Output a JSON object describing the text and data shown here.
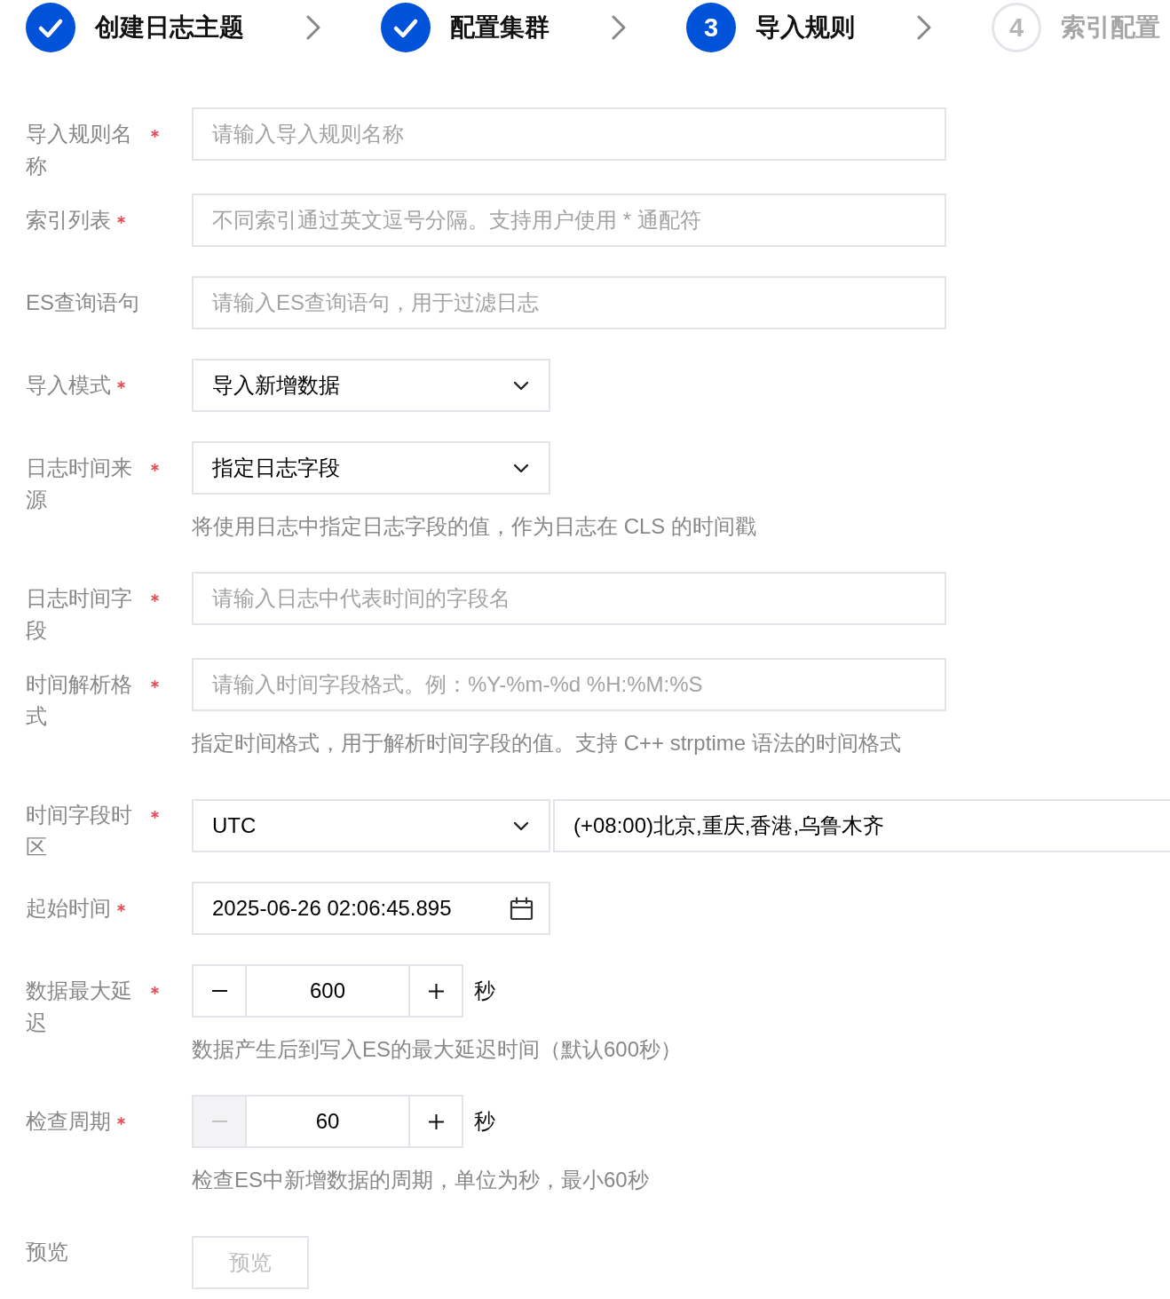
{
  "steps": [
    {
      "label": "创建日志主题",
      "completed": true,
      "selected": false
    },
    {
      "label": "配置集群",
      "completed": true,
      "selected": false
    },
    {
      "number": "3",
      "label": "导入规则",
      "completed": false,
      "selected": true
    },
    {
      "number": "4",
      "label": "索引配置",
      "completed": false,
      "selected": false
    }
  ],
  "form": {
    "fields": [
      {
        "kind": "text",
        "label": "导入规则名称",
        "required": true,
        "placeholder": "请输入导入规则名称"
      },
      {
        "kind": "text",
        "label": "索引列表",
        "required": true,
        "placeholder": "不同索引通过英文逗号分隔。支持用户使用 * 通配符"
      },
      {
        "kind": "text",
        "label": "ES查询语句",
        "required": false,
        "placeholder": "请输入ES查询语句，用于过滤日志"
      },
      {
        "kind": "select",
        "label": "导入模式",
        "required": true,
        "value": "导入新增数据"
      },
      {
        "kind": "select",
        "label": "日志时间来源",
        "required": true,
        "value": "指定日志字段",
        "help": "将使用日志中指定日志字段的值，作为日志在 CLS 的时间戳"
      },
      {
        "kind": "text",
        "label": "日志时间字段",
        "required": true,
        "placeholder": "请输入日志中代表时间的字段名"
      },
      {
        "kind": "text",
        "label": "时间解析格式",
        "required": true,
        "placeholder": "请输入时间字段格式。例：%Y-%m-%d %H:%M:%S",
        "help": "指定时间格式，用于解析时间字段的值。支持 C++ strptime 语法的时间格式"
      },
      {
        "kind": "timezone",
        "label": "时间字段时区",
        "required": true,
        "value": "UTC",
        "zone": "(+08:00)北京,重庆,香港,乌鲁木齐"
      },
      {
        "kind": "date",
        "label": "起始时间",
        "required": true,
        "value": "2025-06-26 02:06:45.895"
      },
      {
        "kind": "stepper",
        "label": "数据最大延迟",
        "required": true,
        "value": "600",
        "unit": "秒",
        "minus_disabled": false,
        "help": "数据产生后到写入ES的最大延迟时间（默认600秒）"
      },
      {
        "kind": "stepper",
        "label": "检查周期",
        "required": true,
        "value": "60",
        "unit": "秒",
        "minus_disabled": true,
        "help": "检查ES中新增数据的周期，单位为秒，最小60秒"
      },
      {
        "kind": "button",
        "label": "预览",
        "required": false,
        "button": "预览",
        "disabled": true
      }
    ]
  }
}
